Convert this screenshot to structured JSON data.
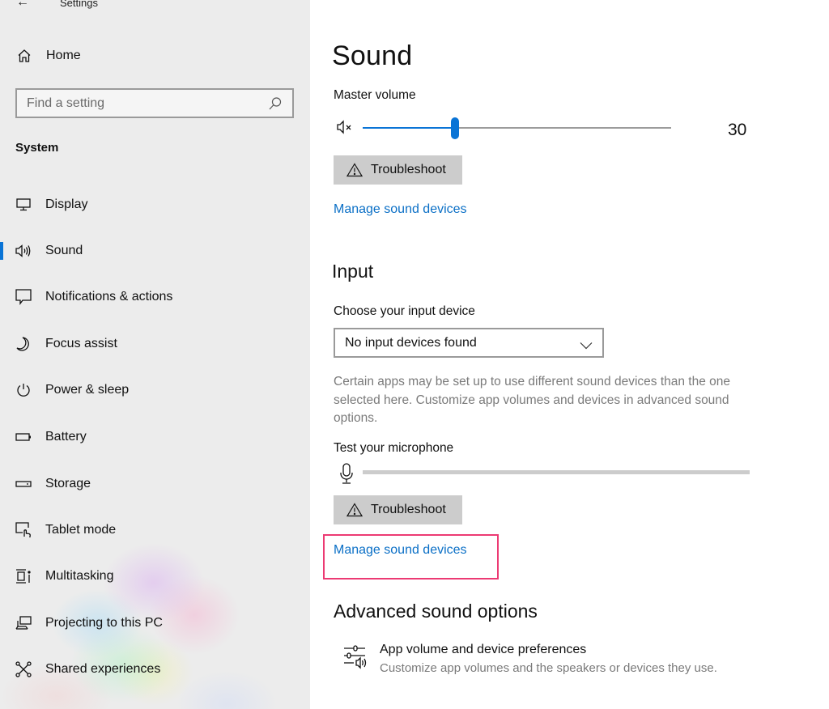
{
  "window": {
    "title": "Settings",
    "back_icon": "back-arrow-icon"
  },
  "sidebar": {
    "home_label": "Home",
    "home_icon": "home-icon",
    "search": {
      "placeholder": "Find a setting",
      "value": "",
      "icon": "search-icon"
    },
    "group_label": "System",
    "items": [
      {
        "label": "Display",
        "icon": "monitor-icon",
        "selected": false
      },
      {
        "label": "Sound",
        "icon": "speaker-icon",
        "selected": true
      },
      {
        "label": "Notifications & actions",
        "icon": "notification-icon",
        "selected": false
      },
      {
        "label": "Focus assist",
        "icon": "moon-icon",
        "selected": false
      },
      {
        "label": "Power & sleep",
        "icon": "power-icon",
        "selected": false
      },
      {
        "label": "Battery",
        "icon": "battery-icon",
        "selected": false
      },
      {
        "label": "Storage",
        "icon": "storage-icon",
        "selected": false
      },
      {
        "label": "Tablet mode",
        "icon": "tablet-mode-icon",
        "selected": false
      },
      {
        "label": "Multitasking",
        "icon": "multitasking-icon",
        "selected": false
      },
      {
        "label": "Projecting to this PC",
        "icon": "projecting-icon",
        "selected": false
      },
      {
        "label": "Shared experiences",
        "icon": "shared-experiences-icon",
        "selected": false
      }
    ]
  },
  "main": {
    "title": "Sound",
    "output": {
      "master_volume_label": "Master volume",
      "mute_icon": "speaker-muted-icon",
      "volume": 30,
      "volume_max": 100,
      "volume_display": "30",
      "troubleshoot_label": "Troubleshoot",
      "manage_link": "Manage sound devices"
    },
    "input": {
      "heading": "Input",
      "choose_label": "Choose your input device",
      "selected_device": "No input devices found",
      "description": "Certain apps may be set up to use different sound devices than the one selected here. Customize app volumes and devices in advanced sound options.",
      "test_label": "Test your microphone",
      "mic_level": 0,
      "troubleshoot_label": "Troubleshoot",
      "manage_link": "Manage sound devices"
    },
    "advanced": {
      "heading": "Advanced sound options",
      "item_title": "App volume and device preferences",
      "item_subtitle": "Customize app volumes and the speakers or devices they use."
    }
  },
  "colors": {
    "accent": "#0a74d6",
    "link": "#0a6fc6",
    "highlight_box": "#ec3a73",
    "button_bg": "#cccccc"
  }
}
